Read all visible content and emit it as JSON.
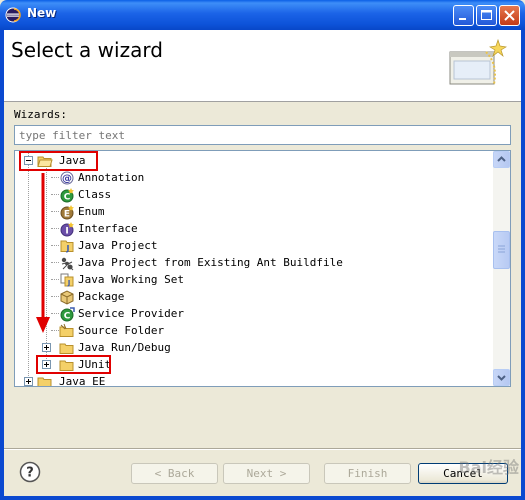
{
  "window": {
    "title": "New",
    "controls": [
      "minimize",
      "maximize",
      "close"
    ]
  },
  "header": {
    "title": "Select a wizard",
    "image_icon": "wizard-banner-icon"
  },
  "wizards_label": "Wizards:",
  "filter": {
    "placeholder": "type filter text",
    "value": ""
  },
  "tree": {
    "items": [
      {
        "label": "Java",
        "level": 0,
        "expanded": true,
        "icon": "folder-open-icon",
        "highlighted": true
      },
      {
        "label": "Annotation",
        "level": 1,
        "icon": "annotation-icon"
      },
      {
        "label": "Class",
        "level": 1,
        "icon": "class-icon"
      },
      {
        "label": "Enum",
        "level": 1,
        "icon": "enum-icon"
      },
      {
        "label": "Interface",
        "level": 1,
        "icon": "interface-icon"
      },
      {
        "label": "Java Project",
        "level": 1,
        "icon": "java-project-icon"
      },
      {
        "label": "Java Project from Existing Ant Buildfile",
        "level": 1,
        "icon": "ant-icon"
      },
      {
        "label": "Java Working Set",
        "level": 1,
        "icon": "working-set-icon"
      },
      {
        "label": "Package",
        "level": 1,
        "icon": "package-icon"
      },
      {
        "label": "Service Provider",
        "level": 1,
        "icon": "service-provider-icon"
      },
      {
        "label": "Source Folder",
        "level": 1,
        "icon": "source-folder-icon"
      },
      {
        "label": "Java Run/Debug",
        "level": 1,
        "expanded": false,
        "icon": "folder-icon"
      },
      {
        "label": "JUnit",
        "level": 1,
        "expanded": false,
        "icon": "folder-icon",
        "highlighted": true
      },
      {
        "label": "Java EE",
        "level": 0,
        "expanded": false,
        "icon": "folder-icon"
      }
    ]
  },
  "buttons": {
    "back": "< Back",
    "next": "Next >",
    "finish": "Finish",
    "cancel": "Cancel"
  },
  "watermark": "Bai经验",
  "colors": {
    "annotation_red": "#e00000",
    "titlebar_blue": "#0a5fe6"
  }
}
